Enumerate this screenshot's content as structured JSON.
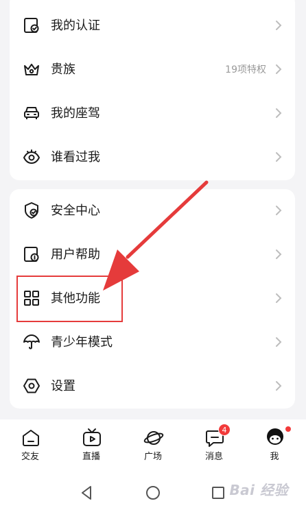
{
  "colors": {
    "background": "#f4f4f6",
    "card": "#ffffff",
    "text": "#1a1a1a",
    "muted": "#9a9a9a",
    "annotation_red": "#e53b3b",
    "badge_red": "#f23a3a"
  },
  "menu_group_1": [
    {
      "icon": "certification-icon",
      "label": "我的认证",
      "value": ""
    },
    {
      "icon": "crown-icon",
      "label": "贵族",
      "value": "19项特权"
    },
    {
      "icon": "car-icon",
      "label": "我的座驾",
      "value": ""
    },
    {
      "icon": "eye-icon",
      "label": "谁看过我",
      "value": ""
    }
  ],
  "menu_group_2": [
    {
      "icon": "shield-icon",
      "label": "安全中心",
      "value": ""
    },
    {
      "icon": "help-document-icon",
      "label": "用户帮助",
      "value": ""
    },
    {
      "icon": "grid-icon",
      "label": "其他功能",
      "value": ""
    },
    {
      "icon": "umbrella-icon",
      "label": "青少年模式",
      "value": ""
    },
    {
      "icon": "settings-icon",
      "label": "设置",
      "value": ""
    }
  ],
  "tabbar": [
    {
      "icon": "home-icon",
      "label": "交友",
      "badge": ""
    },
    {
      "icon": "tv-play-icon",
      "label": "直播",
      "badge": ""
    },
    {
      "icon": "planet-icon",
      "label": "广场",
      "badge": ""
    },
    {
      "icon": "message-icon",
      "label": "消息",
      "badge": "4"
    },
    {
      "icon": "avatar-icon",
      "label": "我",
      "badge": ""
    }
  ],
  "system_nav": {
    "buttons": [
      "back-icon",
      "home-circle-icon",
      "recents-icon"
    ],
    "watermark": "Bai 经验"
  }
}
